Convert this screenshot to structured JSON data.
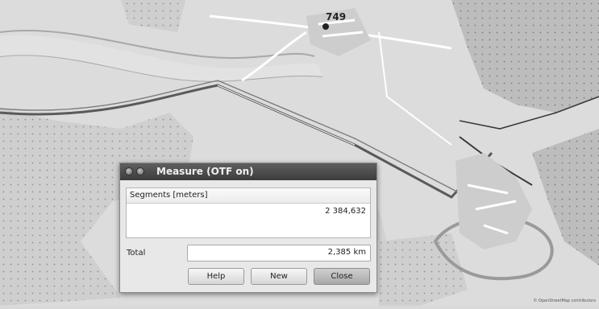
{
  "map": {
    "elevation_label": "749",
    "attribution": "© OpenStreetMap contributors"
  },
  "dialog": {
    "title": "Measure (OTF on)",
    "segments_header": "Segments [meters]",
    "segments": [
      "2 384,632"
    ],
    "total_label": "Total",
    "total_value": "2,385 km",
    "buttons": {
      "help": "Help",
      "new": "New",
      "close": "Close"
    }
  }
}
